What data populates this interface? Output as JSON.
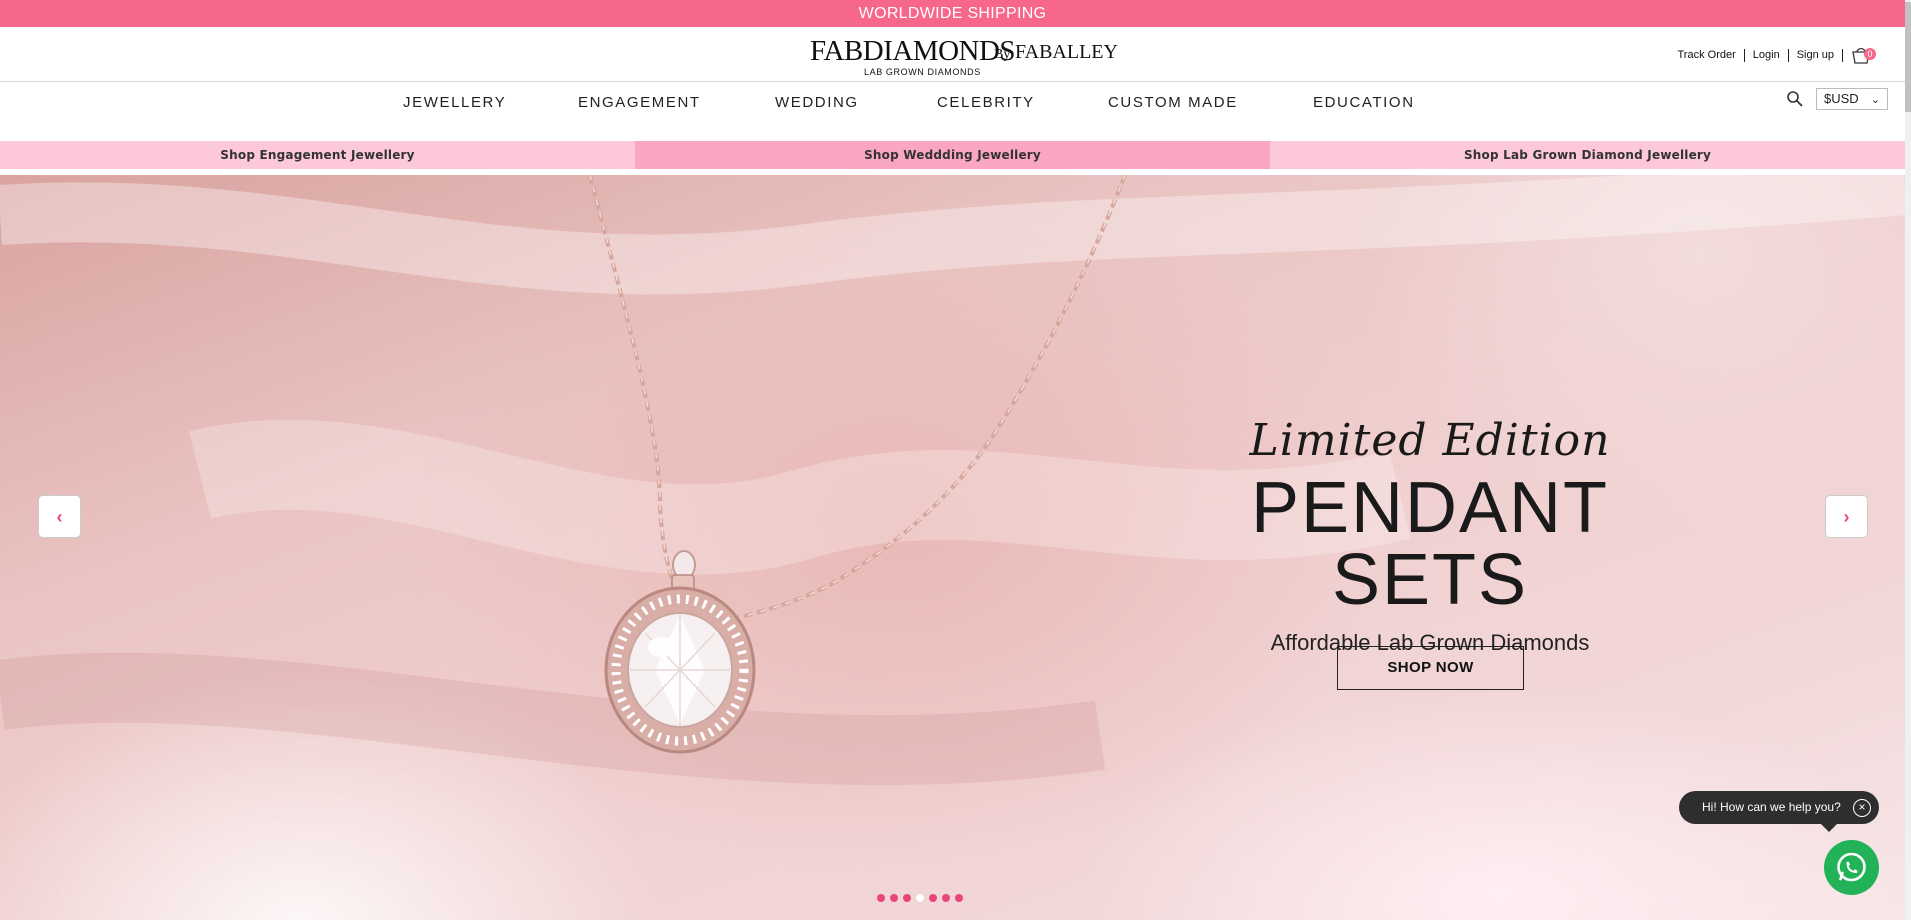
{
  "top_bar": {
    "text": "WORLDWIDE SHIPPING"
  },
  "logo": {
    "main": "FABDIAMONDS",
    "by": "By",
    "partner": "FABALLEY",
    "tagline": "LAB GROWN DIAMONDS"
  },
  "header_links": {
    "track_order": "Track Order",
    "login": "Login",
    "signup": "Sign up",
    "cart_count": "0"
  },
  "nav": {
    "items": [
      {
        "label": "JEWELLERY"
      },
      {
        "label": "ENGAGEMENT"
      },
      {
        "label": "WEDDING"
      },
      {
        "label": "CELEBRITY"
      },
      {
        "label": "CUSTOM MADE"
      },
      {
        "label": "EDUCATION"
      }
    ],
    "currency": "$USD"
  },
  "subnav": {
    "items": [
      {
        "label": "Shop Engagement Jewellery"
      },
      {
        "label": "Shop Weddding Jewellery"
      },
      {
        "label": "Shop Lab Grown Diamond Jewellery"
      }
    ]
  },
  "hero": {
    "script_title": "Limited Edition",
    "title": "PENDANT SETS",
    "subtitle": "Affordable Lab Grown Diamonds",
    "cta": "SHOP NOW",
    "slides_total": 7,
    "active_slide": 4
  },
  "chat": {
    "prompt": "Hi! How can we help you?"
  },
  "colors": {
    "accent": "#f7678a",
    "subnav_light": "#fdc8d8",
    "subnav_mid": "#fba6c1",
    "whatsapp": "#22b358"
  },
  "icons": {
    "search": "search-icon",
    "cart": "cart-icon",
    "prev": "chevron-left-icon",
    "next": "chevron-right-icon",
    "close": "close-icon",
    "whatsapp": "whatsapp-icon"
  }
}
